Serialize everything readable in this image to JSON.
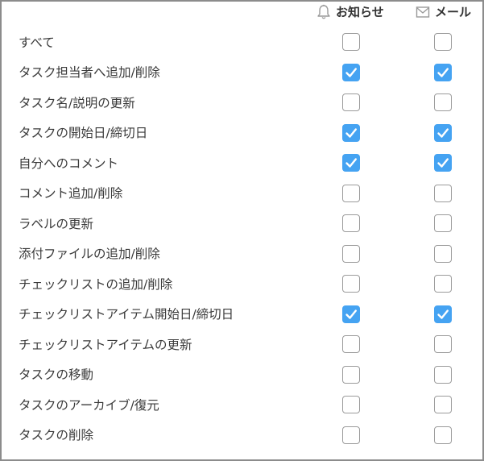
{
  "header": {
    "notify_label": "お知らせ",
    "notify_icon": "bell-icon",
    "mail_label": "メール",
    "mail_icon": "envelope-icon"
  },
  "colors": {
    "checked": "#45a3f2",
    "unchecked_border": "#9b9b9b",
    "frame_border": "#8c8c8c"
  },
  "rows": [
    {
      "label": "すべて",
      "notify": false,
      "mail": false
    },
    {
      "label": "タスク担当者へ追加/削除",
      "notify": true,
      "mail": true
    },
    {
      "label": "タスク名/説明の更新",
      "notify": false,
      "mail": false
    },
    {
      "label": "タスクの開始日/締切日",
      "notify": true,
      "mail": true
    },
    {
      "label": "自分へのコメント",
      "notify": true,
      "mail": true
    },
    {
      "label": "コメント追加/削除",
      "notify": false,
      "mail": false
    },
    {
      "label": "ラベルの更新",
      "notify": false,
      "mail": false
    },
    {
      "label": "添付ファイルの追加/削除",
      "notify": false,
      "mail": false
    },
    {
      "label": "チェックリストの追加/削除",
      "notify": false,
      "mail": false
    },
    {
      "label": "チェックリストアイテム開始日/締切日",
      "notify": true,
      "mail": true
    },
    {
      "label": "チェックリストアイテムの更新",
      "notify": false,
      "mail": false
    },
    {
      "label": "タスクの移動",
      "notify": false,
      "mail": false
    },
    {
      "label": "タスクのアーカイブ/復元",
      "notify": false,
      "mail": false
    },
    {
      "label": "タスクの削除",
      "notify": false,
      "mail": false
    }
  ]
}
